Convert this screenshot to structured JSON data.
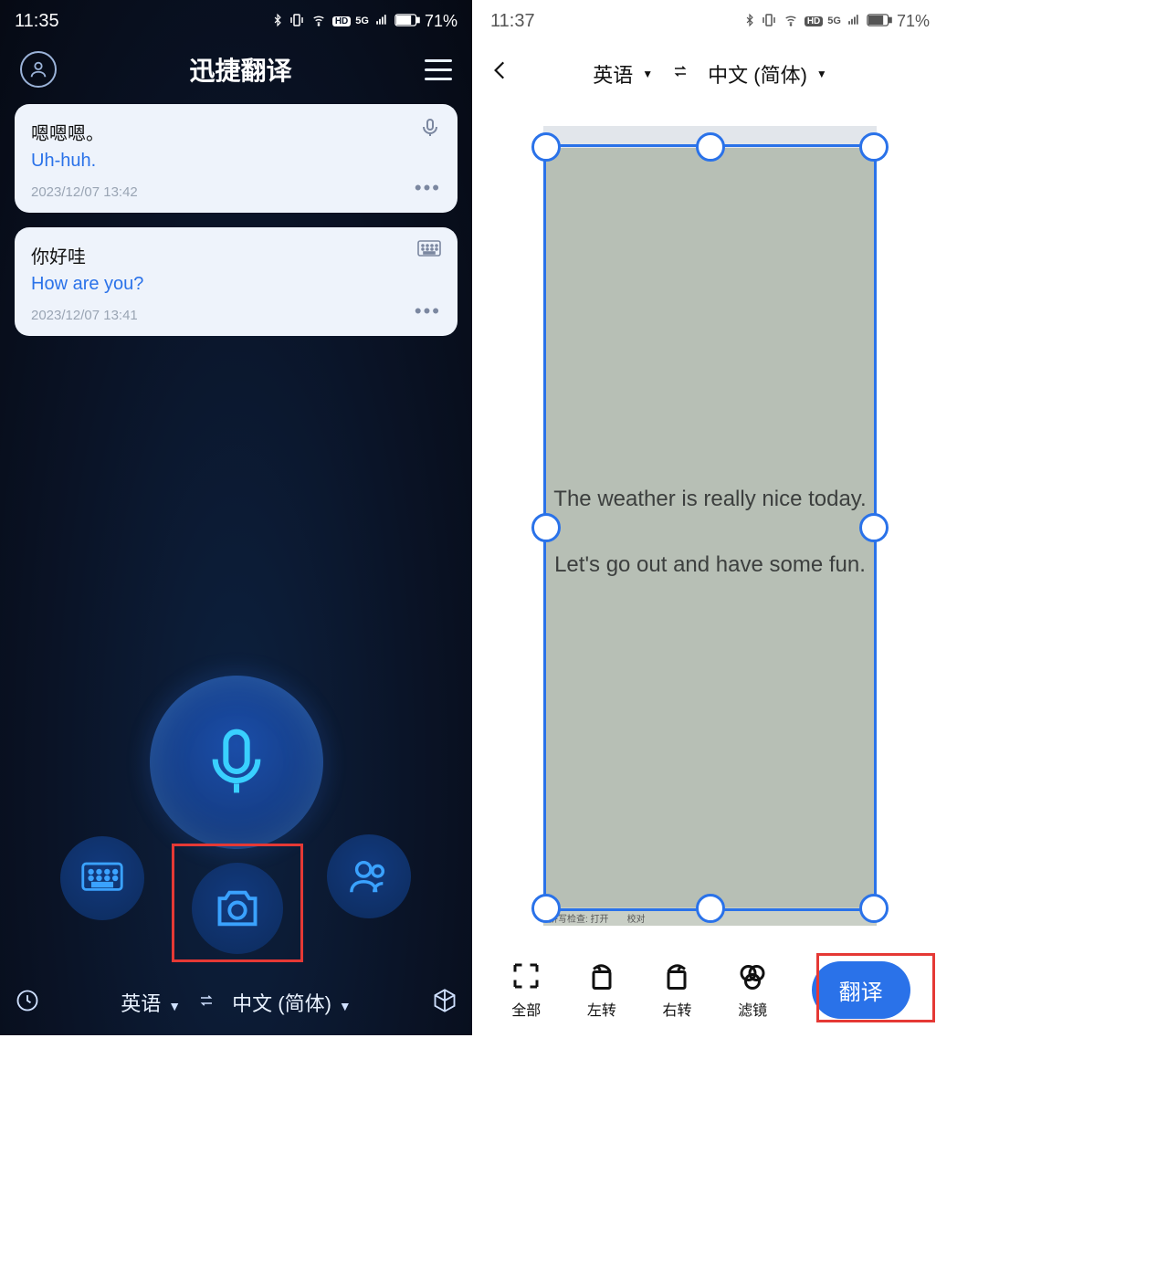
{
  "left": {
    "status": {
      "time": "11:35",
      "battery": "71%",
      "network": "5G"
    },
    "header": {
      "title": "迅捷翻译"
    },
    "history": [
      {
        "src": "嗯嗯嗯。",
        "tgt": "Uh-huh.",
        "time": "2023/12/07 13:42",
        "input_mode": "mic"
      },
      {
        "src": "你好哇",
        "tgt": "How are you?",
        "time": "2023/12/07 13:41",
        "input_mode": "keyboard"
      }
    ],
    "langbar": {
      "from": "英语",
      "to": "中文 (简体)"
    }
  },
  "right": {
    "status": {
      "time": "11:37",
      "battery": "71%",
      "network": "5G"
    },
    "langbar": {
      "from": "英语",
      "to": "中文 (简体)"
    },
    "photo_text": {
      "line1": "The weather is really nice today.",
      "line2": "Let's go out and have some fun.",
      "footer1": "拼写检查: 打开",
      "footer2": "校对"
    },
    "toolbar": {
      "full": "全部",
      "rotate_left": "左转",
      "rotate_right": "右转",
      "filter": "滤镜",
      "translate": "翻译"
    }
  },
  "highlight_color": "#e53935",
  "accent_color": "#2a72e9"
}
